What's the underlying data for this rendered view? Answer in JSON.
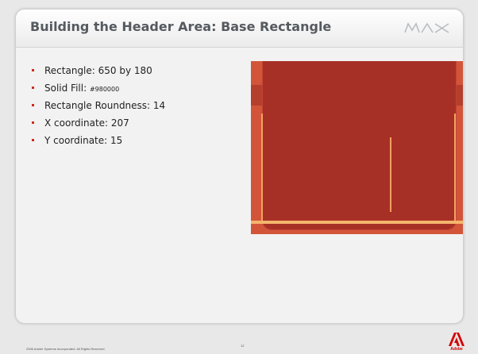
{
  "slide": {
    "title": "Building the Header Area: Base Rectangle",
    "logo_name": "MAX",
    "bullets": [
      {
        "text": "Rectangle: 650 by 180"
      },
      {
        "text": "Solid Fill: ",
        "small": "#980000"
      },
      {
        "text": "Rectangle Roundness: 14"
      },
      {
        "text": "X coordinate: 207"
      },
      {
        "text": "Y coordinate: 15"
      }
    ]
  },
  "footer": {
    "copyright": "2006 Adobe Systems Incorporated.  All Rights Reserved.",
    "page_number": "12",
    "adobe_label": "Adobe"
  },
  "colors": {
    "accent": "#cc2b1b",
    "preview_bg": "#d2553a",
    "base_rect": "#a73026",
    "highlight": "#f4b56d"
  },
  "icons": [
    "max-logo-icon",
    "adobe-logo-icon",
    "bullet-icon"
  ]
}
